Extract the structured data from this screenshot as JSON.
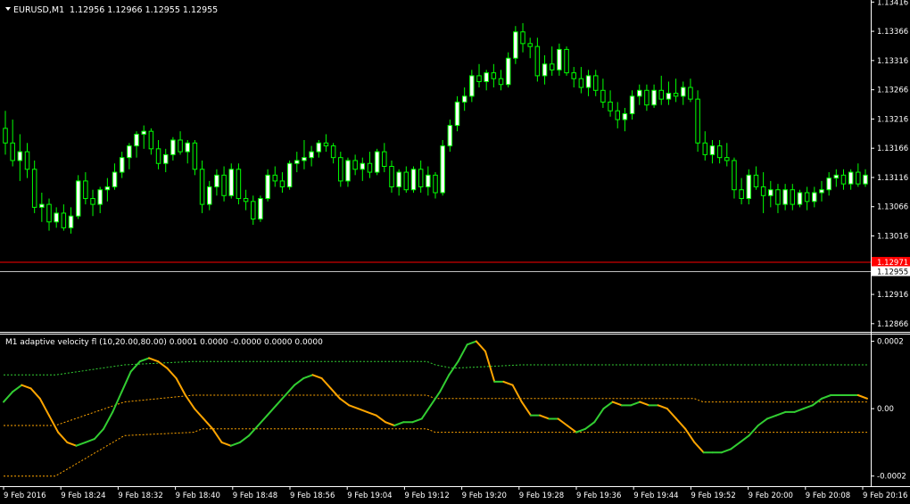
{
  "chart_data": [
    {
      "type": "candlestick",
      "symbol": "EURUSD,M1",
      "quote": "1.12956 1.12966 1.12955 1.12955",
      "colors": {
        "background": "#000000",
        "bull": "#ffffff",
        "bear": "#000000",
        "wick": "#00ff00",
        "bid_line": "#ff0000",
        "ask_line": "#c0c0c0"
      },
      "y_ticks": [
        "1.13416",
        "1.13366",
        "1.13316",
        "1.13266",
        "1.13216",
        "1.13166",
        "1.13116",
        "1.13066",
        "1.13016",
        "1.12916",
        "1.12866"
      ],
      "ylim": [
        1.12852,
        1.13418
      ],
      "bid_label": "1.12971",
      "bid": 1.12971,
      "ask_label": "1.12955",
      "ask": 1.12955,
      "x_ticks": [
        "9 Feb 2016",
        "9 Feb 18:24",
        "9 Feb 18:32",
        "9 Feb 18:40",
        "9 Feb 18:48",
        "9 Feb 18:56",
        "9 Feb 19:04",
        "9 Feb 19:12",
        "9 Feb 19:20",
        "9 Feb 19:28",
        "9 Feb 19:36",
        "9 Feb 19:44",
        "9 Feb 19:52",
        "9 Feb 20:00",
        "9 Feb 20:08",
        "9 Feb 20:16"
      ],
      "candles": [
        [
          1.132,
          1.1323,
          1.13155,
          1.13175
        ],
        [
          1.13175,
          1.13215,
          1.13135,
          1.13145
        ],
        [
          1.13145,
          1.1319,
          1.1311,
          1.1316
        ],
        [
          1.1316,
          1.13175,
          1.13115,
          1.1313
        ],
        [
          1.1313,
          1.13145,
          1.13055,
          1.13065
        ],
        [
          1.13065,
          1.1309,
          1.1304,
          1.1307
        ],
        [
          1.1307,
          1.1308,
          1.13025,
          1.1304
        ],
        [
          1.1304,
          1.13065,
          1.1303,
          1.13055
        ],
        [
          1.13055,
          1.1307,
          1.13025,
          1.1303
        ],
        [
          1.1303,
          1.13065,
          1.1302,
          1.1305
        ],
        [
          1.1305,
          1.1312,
          1.13045,
          1.1311
        ],
        [
          1.1311,
          1.13125,
          1.1307,
          1.1308
        ],
        [
          1.1308,
          1.13095,
          1.1305,
          1.1307
        ],
        [
          1.1307,
          1.131,
          1.13055,
          1.13095
        ],
        [
          1.13095,
          1.13115,
          1.13075,
          1.131
        ],
        [
          1.131,
          1.1314,
          1.13095,
          1.13125
        ],
        [
          1.13125,
          1.1316,
          1.13115,
          1.1315
        ],
        [
          1.1315,
          1.13175,
          1.1313,
          1.1317
        ],
        [
          1.1317,
          1.13195,
          1.1315,
          1.1319
        ],
        [
          1.1319,
          1.13205,
          1.13165,
          1.13195
        ],
        [
          1.13195,
          1.132,
          1.13155,
          1.13165
        ],
        [
          1.13165,
          1.1318,
          1.1313,
          1.1314
        ],
        [
          1.1314,
          1.13165,
          1.13125,
          1.13155
        ],
        [
          1.13155,
          1.13185,
          1.13145,
          1.1318
        ],
        [
          1.1318,
          1.13195,
          1.13155,
          1.1316
        ],
        [
          1.1316,
          1.1318,
          1.1314,
          1.13175
        ],
        [
          1.13175,
          1.1318,
          1.1312,
          1.1313
        ],
        [
          1.1313,
          1.13145,
          1.13055,
          1.1307
        ],
        [
          1.1307,
          1.1311,
          1.1306,
          1.131
        ],
        [
          1.131,
          1.1313,
          1.13085,
          1.1312
        ],
        [
          1.1312,
          1.13135,
          1.13075,
          1.13085
        ],
        [
          1.13085,
          1.1314,
          1.1308,
          1.1313
        ],
        [
          1.1313,
          1.1314,
          1.1307,
          1.1308
        ],
        [
          1.1308,
          1.13095,
          1.1306,
          1.13075
        ],
        [
          1.13075,
          1.13085,
          1.13035,
          1.13045
        ],
        [
          1.13045,
          1.13085,
          1.1304,
          1.1308
        ],
        [
          1.1308,
          1.1313,
          1.13075,
          1.1312
        ],
        [
          1.1312,
          1.13135,
          1.131,
          1.1311
        ],
        [
          1.1311,
          1.13125,
          1.1309,
          1.131
        ],
        [
          1.131,
          1.13145,
          1.13095,
          1.1314
        ],
        [
          1.1314,
          1.1316,
          1.13125,
          1.13145
        ],
        [
          1.13145,
          1.1318,
          1.1313,
          1.1315
        ],
        [
          1.1315,
          1.1317,
          1.13135,
          1.1316
        ],
        [
          1.1316,
          1.1318,
          1.1315,
          1.13175
        ],
        [
          1.13175,
          1.1319,
          1.1316,
          1.1317
        ],
        [
          1.1317,
          1.13175,
          1.1314,
          1.1315
        ],
        [
          1.1315,
          1.1316,
          1.131,
          1.1311
        ],
        [
          1.1311,
          1.1315,
          1.131,
          1.13145
        ],
        [
          1.13145,
          1.13155,
          1.1312,
          1.1313
        ],
        [
          1.1313,
          1.1315,
          1.1311,
          1.1314
        ],
        [
          1.1314,
          1.1316,
          1.13115,
          1.13125
        ],
        [
          1.13125,
          1.13165,
          1.1312,
          1.1316
        ],
        [
          1.1316,
          1.13175,
          1.13125,
          1.13135
        ],
        [
          1.13135,
          1.13145,
          1.1309,
          1.131
        ],
        [
          1.131,
          1.1313,
          1.13085,
          1.13125
        ],
        [
          1.13125,
          1.13135,
          1.1309,
          1.13095
        ],
        [
          1.13095,
          1.13135,
          1.1309,
          1.1313
        ],
        [
          1.1313,
          1.13145,
          1.1309,
          1.131
        ],
        [
          1.131,
          1.13135,
          1.13085,
          1.1312
        ],
        [
          1.1312,
          1.13125,
          1.1308,
          1.1309
        ],
        [
          1.1309,
          1.1318,
          1.13085,
          1.1317
        ],
        [
          1.1317,
          1.13215,
          1.1316,
          1.13205
        ],
        [
          1.13205,
          1.13255,
          1.13195,
          1.13245
        ],
        [
          1.13245,
          1.1327,
          1.1323,
          1.13255
        ],
        [
          1.13255,
          1.133,
          1.13245,
          1.1329
        ],
        [
          1.1329,
          1.1331,
          1.1327,
          1.1328
        ],
        [
          1.1328,
          1.133,
          1.13265,
          1.13295
        ],
        [
          1.13295,
          1.1331,
          1.1327,
          1.13285
        ],
        [
          1.13285,
          1.133,
          1.13265,
          1.13275
        ],
        [
          1.13275,
          1.1333,
          1.1327,
          1.1332
        ],
        [
          1.1332,
          1.13375,
          1.1331,
          1.13365
        ],
        [
          1.13365,
          1.1338,
          1.1333,
          1.13345
        ],
        [
          1.13345,
          1.13355,
          1.1332,
          1.1334
        ],
        [
          1.1334,
          1.13355,
          1.1328,
          1.1329
        ],
        [
          1.1329,
          1.13325,
          1.13275,
          1.1331
        ],
        [
          1.1331,
          1.1334,
          1.1329,
          1.133
        ],
        [
          1.133,
          1.13345,
          1.1329,
          1.13335
        ],
        [
          1.13335,
          1.1334,
          1.1329,
          1.13295
        ],
        [
          1.13295,
          1.13305,
          1.1327,
          1.13285
        ],
        [
          1.13285,
          1.13305,
          1.1326,
          1.1327
        ],
        [
          1.1327,
          1.133,
          1.13255,
          1.1329
        ],
        [
          1.1329,
          1.133,
          1.13255,
          1.13265
        ],
        [
          1.13265,
          1.13285,
          1.13235,
          1.13245
        ],
        [
          1.13245,
          1.13265,
          1.1322,
          1.1323
        ],
        [
          1.1323,
          1.13245,
          1.132,
          1.13215
        ],
        [
          1.13215,
          1.13235,
          1.13195,
          1.13225
        ],
        [
          1.13225,
          1.13265,
          1.13215,
          1.13255
        ],
        [
          1.13255,
          1.13275,
          1.1324,
          1.13265
        ],
        [
          1.13265,
          1.13275,
          1.1323,
          1.1324
        ],
        [
          1.1324,
          1.13275,
          1.13235,
          1.13265
        ],
        [
          1.13265,
          1.1329,
          1.1324,
          1.1325
        ],
        [
          1.1325,
          1.1328,
          1.1324,
          1.1326
        ],
        [
          1.1326,
          1.13285,
          1.13245,
          1.13255
        ],
        [
          1.13255,
          1.1328,
          1.1324,
          1.1327
        ],
        [
          1.1327,
          1.13285,
          1.13245,
          1.1325
        ],
        [
          1.1325,
          1.13265,
          1.1316,
          1.13175
        ],
        [
          1.13175,
          1.13195,
          1.13145,
          1.13155
        ],
        [
          1.13155,
          1.1318,
          1.1314,
          1.1317
        ],
        [
          1.1317,
          1.1318,
          1.1314,
          1.1315
        ],
        [
          1.1315,
          1.13175,
          1.13135,
          1.13145
        ],
        [
          1.13145,
          1.1315,
          1.1308,
          1.13095
        ],
        [
          1.13095,
          1.13115,
          1.1307,
          1.1308
        ],
        [
          1.1308,
          1.1313,
          1.1307,
          1.1312
        ],
        [
          1.1312,
          1.13135,
          1.13095,
          1.131
        ],
        [
          1.131,
          1.13125,
          1.13055,
          1.13085
        ],
        [
          1.13085,
          1.1311,
          1.13065,
          1.13095
        ],
        [
          1.13095,
          1.13105,
          1.13055,
          1.1307
        ],
        [
          1.1307,
          1.13105,
          1.1306,
          1.13095
        ],
        [
          1.13095,
          1.13105,
          1.1306,
          1.1307
        ],
        [
          1.1307,
          1.13095,
          1.13065,
          1.1309
        ],
        [
          1.1309,
          1.131,
          1.1306,
          1.13075
        ],
        [
          1.13075,
          1.131,
          1.13065,
          1.1309
        ],
        [
          1.1309,
          1.1311,
          1.13075,
          1.13095
        ],
        [
          1.13095,
          1.13125,
          1.13085,
          1.13115
        ],
        [
          1.13115,
          1.1313,
          1.131,
          1.1312
        ],
        [
          1.1312,
          1.1313,
          1.13095,
          1.13105
        ],
        [
          1.13105,
          1.1313,
          1.13095,
          1.13125
        ],
        [
          1.13125,
          1.1314,
          1.131,
          1.13105
        ],
        [
          1.13105,
          1.1313,
          1.131,
          1.1312
        ]
      ]
    },
    {
      "type": "line",
      "title": "M1 adaptive velocity fl (10,20.00,80.00) 0.0001 0.0000 -0.0000 0.0000 0.0000",
      "y_ticks": [
        "0.0002",
        "0.00",
        "-0.0002"
      ],
      "ylim": [
        -0.00023,
        0.00022
      ],
      "colors": {
        "up": "#32cd32",
        "down": "#ffa500",
        "upper_band": "#32cd32",
        "mid_band": "#ffa500",
        "lower_band": "#ffa500"
      },
      "velocity": [
        2e-05,
        5e-05,
        7e-05,
        6e-05,
        3e-05,
        -2e-05,
        -7e-05,
        -0.0001,
        -0.00011,
        -0.0001,
        -9e-05,
        -6e-05,
        -1e-05,
        5e-05,
        0.00011,
        0.00014,
        0.00015,
        0.00014,
        0.00012,
        9e-05,
        4e-05,
        0.0,
        -3e-05,
        -6e-05,
        -0.0001,
        -0.00011,
        -0.0001,
        -8e-05,
        -5e-05,
        -2e-05,
        1e-05,
        4e-05,
        7e-05,
        9e-05,
        0.0001,
        9e-05,
        6e-05,
        3e-05,
        1e-05,
        0.0,
        -1e-05,
        -2e-05,
        -4e-05,
        -5e-05,
        -4e-05,
        -4e-05,
        -3e-05,
        1e-05,
        5e-05,
        0.0001,
        0.00014,
        0.00019,
        0.0002,
        0.00017,
        8e-05,
        8e-05,
        7e-05,
        2e-05,
        -2e-05,
        -2e-05,
        -3e-05,
        -3e-05,
        -5e-05,
        -7e-05,
        -6e-05,
        -4e-05,
        0.0,
        2e-05,
        1e-05,
        1e-05,
        2e-05,
        1e-05,
        1e-05,
        0.0,
        -3e-05,
        -6e-05,
        -0.0001,
        -0.00013,
        -0.00013,
        -0.00013,
        -0.00012,
        -0.0001,
        -8e-05,
        -5e-05,
        -3e-05,
        -2e-05,
        -1e-05,
        -1e-05,
        0.0,
        1e-05,
        3e-05,
        4e-05,
        4e-05,
        4e-05,
        4e-05,
        3e-05
      ],
      "bands": {
        "x_fraction": [
          0.0,
          0.06,
          0.14,
          0.22,
          0.23,
          0.49,
          0.5,
          0.52,
          0.6,
          0.8,
          0.81,
          1.0
        ],
        "upper": [
          0.0001,
          0.0001,
          0.00013,
          0.00014,
          0.00014,
          0.00014,
          0.00013,
          0.00012,
          0.00013,
          0.00013,
          0.00013,
          0.00013
        ],
        "middle": [
          -5e-05,
          -5e-05,
          2e-05,
          4e-05,
          4e-05,
          4e-05,
          3e-05,
          3e-05,
          3e-05,
          3e-05,
          2e-05,
          2e-05
        ],
        "lower": [
          -0.0002,
          -0.0002,
          -8e-05,
          -7e-05,
          -6e-05,
          -6e-05,
          -7e-05,
          -7e-05,
          -7e-05,
          -7e-05,
          -7e-05,
          -7e-05
        ]
      }
    }
  ]
}
